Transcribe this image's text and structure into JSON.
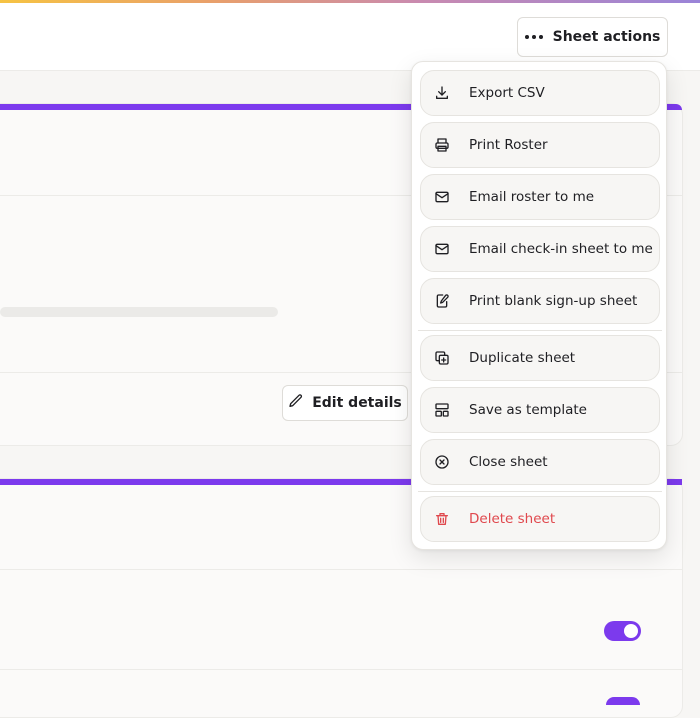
{
  "header": {
    "sheet_actions_label": "Sheet actions"
  },
  "card1": {
    "edit_details_label": "Edit details"
  },
  "menu": {
    "items": [
      {
        "label": "Export CSV",
        "icon": "download-icon"
      },
      {
        "label": "Print Roster",
        "icon": "printer-icon"
      },
      {
        "label": "Email roster to me",
        "icon": "mail-icon"
      },
      {
        "label": "Email check-in sheet to me",
        "icon": "mail-icon"
      },
      {
        "label": "Print blank sign-up sheet",
        "icon": "edit-document-icon"
      },
      {
        "label": "Duplicate sheet",
        "icon": "duplicate-icon"
      },
      {
        "label": "Save as template",
        "icon": "template-icon"
      },
      {
        "label": "Close sheet",
        "icon": "close-circle-icon"
      },
      {
        "label": "Delete sheet",
        "icon": "trash-icon"
      }
    ]
  },
  "toggle": {
    "on": true
  },
  "colors": {
    "accent": "#7c3aed",
    "danger": "#e0484d"
  }
}
